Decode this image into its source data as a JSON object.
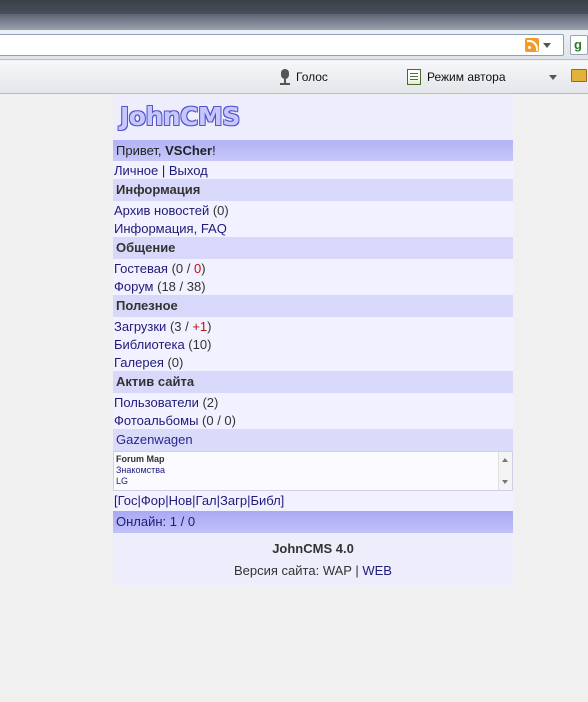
{
  "browser": {
    "toolbar": {
      "voice_label": "Голос",
      "author_mode_label": "Режим автора"
    },
    "google_icon_text": "g"
  },
  "site": {
    "logo_text": "JohnCMS",
    "greeting": {
      "prefix": "Привет, ",
      "user": "VSCher",
      "suffix": "!"
    },
    "account_links": {
      "personal": "Личное",
      "sep": " | ",
      "logout": "Выход"
    },
    "sections": {
      "info": {
        "title": "Информация",
        "items": [
          {
            "label": "Архив новостей",
            "count": " (0)"
          },
          {
            "label": "Информация, FAQ"
          }
        ]
      },
      "social": {
        "title": "Общение",
        "guest": {
          "label": "Гостевая",
          "open": " (0 / ",
          "new": "0",
          "close": ")"
        },
        "forum": {
          "label": "Форум",
          "count": " (18 / 38)"
        }
      },
      "useful": {
        "title": "Полезное",
        "downloads": {
          "label": "Загрузки",
          "open": " (3 / ",
          "new": "+1",
          "close": ")"
        },
        "library": {
          "label": "Библиотека",
          "count": " (10)"
        },
        "gallery": {
          "label": "Галерея",
          "count": " (0)"
        }
      },
      "activity": {
        "title": "Актив сайта",
        "users": {
          "label": "Пользователи",
          "count": " (2)"
        },
        "albums": {
          "label": "Фотоальбомы",
          "count": " (0 / 0)"
        }
      }
    },
    "ad_block_title": "Gazenwagen",
    "mini_links": [
      "Forum Map",
      "Знакомства",
      "LG"
    ],
    "quick_nav": "[Гос|Фор|Нов|Гал|Загр|Библ]",
    "online": "Онлайн: 1 / 0",
    "footer": {
      "brand": "JohnCMS 4.0",
      "version_prefix": "Версия сайта: ",
      "wap": "WAP",
      "sep": " | ",
      "web": "WEB"
    }
  }
}
